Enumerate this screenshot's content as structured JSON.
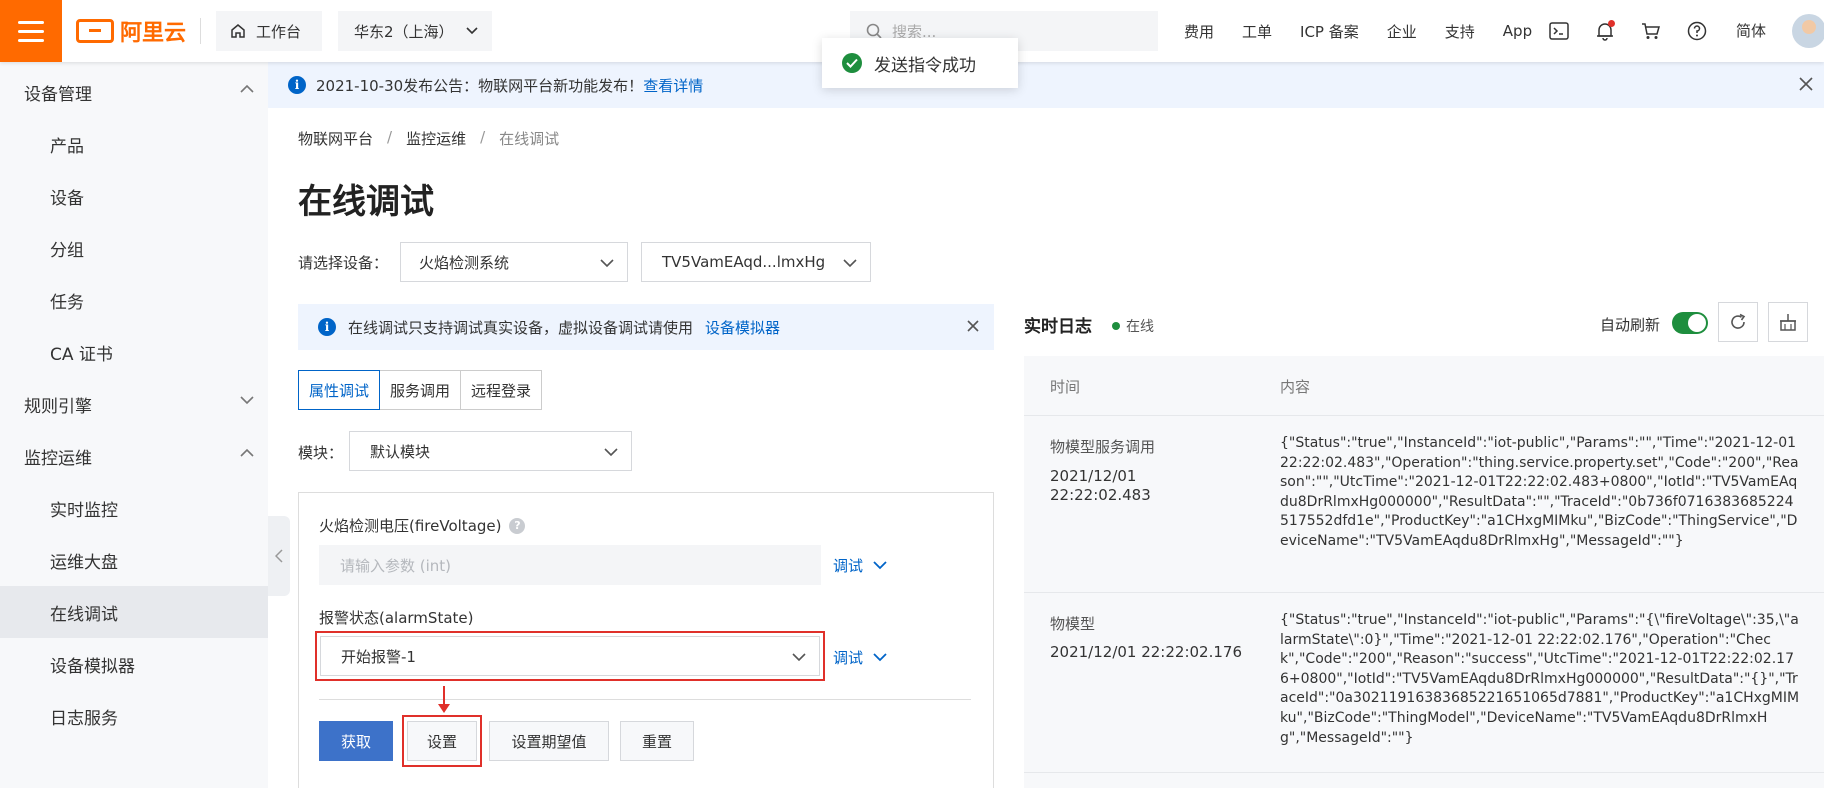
{
  "topbar": {
    "brand": "阿里云",
    "workbench": "工作台",
    "region": "华东2（上海）",
    "search_placeholder": "搜索...",
    "nav": [
      "费用",
      "工单",
      "ICP 备案",
      "企业",
      "支持",
      "App"
    ],
    "lang": "简体"
  },
  "toast": {
    "message": "发送指令成功"
  },
  "announcement": {
    "text": "2021-10-30发布公告：物联网平台新功能发布！",
    "link": "查看详情"
  },
  "sidebar": {
    "groups": [
      {
        "label": "设备管理",
        "expanded": true,
        "items": [
          "产品",
          "设备",
          "分组",
          "任务",
          "CA 证书"
        ]
      },
      {
        "label": "规则引擎",
        "expanded": false,
        "items": []
      },
      {
        "label": "监控运维",
        "expanded": true,
        "items": [
          "实时监控",
          "运维大盘",
          "在线调试",
          "设备模拟器",
          "日志服务"
        ]
      }
    ],
    "active_item": "在线调试"
  },
  "breadcrumb": [
    "物联网平台",
    "监控运维",
    "在线调试"
  ],
  "page_title": "在线调试",
  "device_select": {
    "label": "请选择设备：",
    "product": "火焰检测系统",
    "device": "TV5VamEAqd...lmxHg"
  },
  "tip": {
    "text": "在线调试只支持调试真实设备，虚拟设备调试请使用",
    "link": "设备模拟器"
  },
  "tabs": [
    {
      "label": "属性调试",
      "active": true
    },
    {
      "label": "服务调用",
      "active": false
    },
    {
      "label": "远程登录",
      "active": false
    }
  ],
  "module": {
    "label": "模块：",
    "value": "默认模块"
  },
  "properties": {
    "fire_voltage": {
      "label": "火焰检测电压(fireVoltage)",
      "placeholder": "请输入参数 (int)",
      "debug": "调试"
    },
    "alarm_state": {
      "label": "报警状态(alarmState)",
      "value": "开始报警-1",
      "debug": "调试"
    }
  },
  "buttons": {
    "get": "获取",
    "set": "设置",
    "set_expected": "设置期望值",
    "reset": "重置"
  },
  "log": {
    "title": "实时日志",
    "status": "在线",
    "auto_refresh_label": "自动刷新",
    "auto_refresh": true,
    "columns": [
      "时间",
      "内容"
    ],
    "rows": [
      {
        "type": "物模型服务调用",
        "time": "2021/12/01 22:22:02.483",
        "content": "{\"Status\":\"true\",\"InstanceId\":\"iot-public\",\"Params\":\"\",\"Time\":\"2021-12-01 22:22:02.483\",\"Operation\":\"thing.service.property.set\",\"Code\":\"200\",\"Reason\":\"\",\"UtcTime\":\"2021-12-01T22:22:02.483+0800\",\"IotId\":\"TV5VamEAqdu8DrRlmxHg000000\",\"ResultData\":\"\",\"TraceId\":\"0b736f0716383685224517552dfd1e\",\"ProductKey\":\"a1CHxgMIMku\",\"BizCode\":\"ThingService\",\"DeviceName\":\"TV5VamEAqdu8DrRlmxHg\",\"MessageId\":\"\"}"
      },
      {
        "type": "物模型",
        "time": "2021/12/01 22:22:02.176",
        "content": "{\"Status\":\"true\",\"InstanceId\":\"iot-public\",\"Params\":\"{\\\"fireVoltage\\\":35,\\\"alarmState\\\":0}\",\"Time\":\"2021-12-01 22:22:02.176\",\"Operation\":\"Check\",\"Code\":\"200\",\"Reason\":\"success\",\"UtcTime\":\"2021-12-01T22:22:02.176+0800\",\"IotId\":\"TV5VamEAqdu8DrRlmxHg000000\",\"ResultData\":\"{}\",\"TraceId\":\"0a30211916383685221651065d7881\",\"ProductKey\":\"a1CHxgMIMku\",\"BizCode\":\"ThingModel\",\"DeviceName\":\"TV5VamEAqdu8DrRlmxHg\",\"MessageId\":\"\"}"
      }
    ]
  },
  "colors": {
    "brand": "#ff6a00",
    "link": "#0064c8",
    "primary_button": "#3d72c9",
    "success": "#1e8e3e",
    "annotation": "#e0302a"
  }
}
